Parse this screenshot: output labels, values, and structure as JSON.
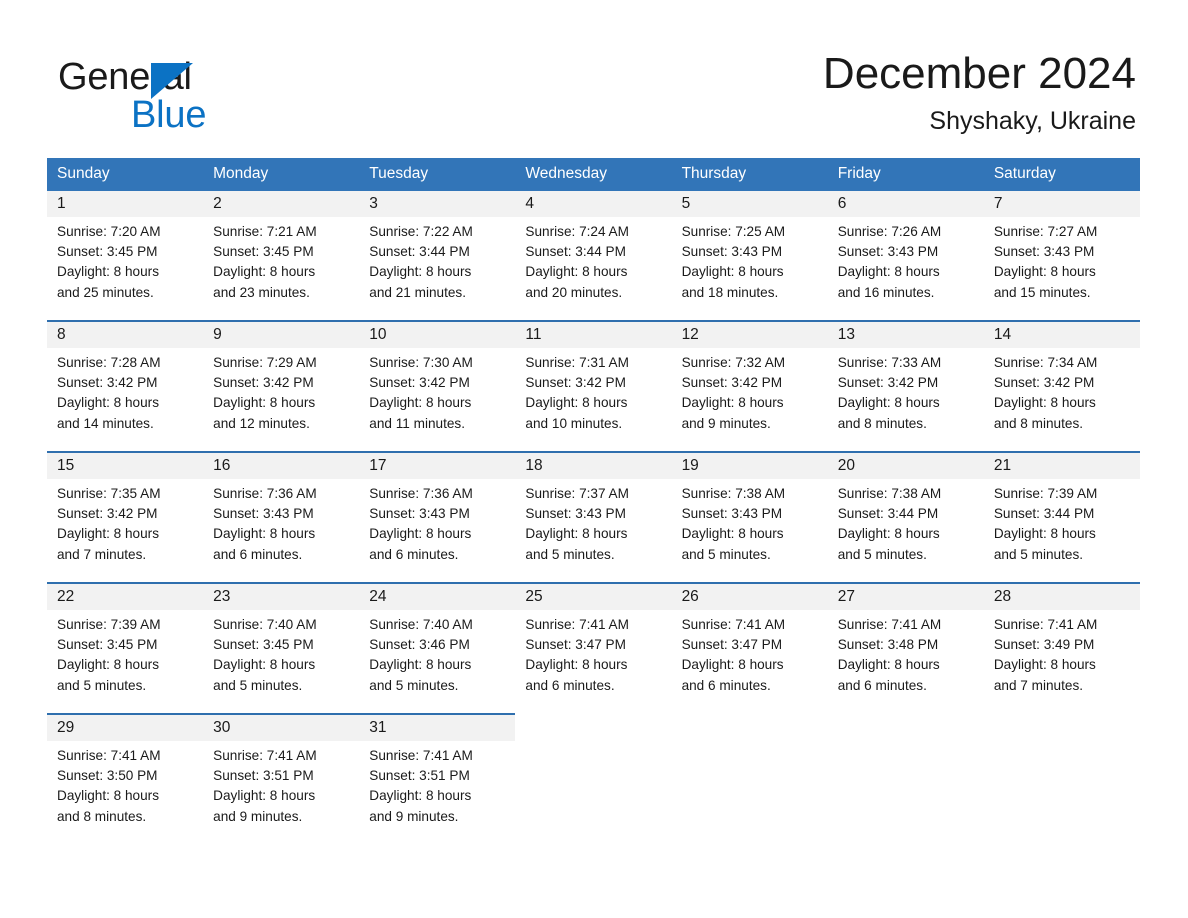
{
  "brand": {
    "name_dark": "General",
    "name_blue": "Blue",
    "accent_color": "#0b72c4"
  },
  "header": {
    "title": "December 2024",
    "location": "Shyshaky, Ukraine"
  },
  "theme": {
    "header_blue": "#3275b8",
    "rule_blue": "#2f6fae",
    "daynum_band": "#f2f2f2",
    "text": "#1a1a1a"
  },
  "weekday_headers": [
    "Sunday",
    "Monday",
    "Tuesday",
    "Wednesday",
    "Thursday",
    "Friday",
    "Saturday"
  ],
  "weeks": [
    {
      "days": [
        {
          "num": "1",
          "sunrise": "Sunrise: 7:20 AM",
          "sunset": "Sunset: 3:45 PM",
          "daylight1": "Daylight: 8 hours",
          "daylight2": "and 25 minutes."
        },
        {
          "num": "2",
          "sunrise": "Sunrise: 7:21 AM",
          "sunset": "Sunset: 3:45 PM",
          "daylight1": "Daylight: 8 hours",
          "daylight2": "and 23 minutes."
        },
        {
          "num": "3",
          "sunrise": "Sunrise: 7:22 AM",
          "sunset": "Sunset: 3:44 PM",
          "daylight1": "Daylight: 8 hours",
          "daylight2": "and 21 minutes."
        },
        {
          "num": "4",
          "sunrise": "Sunrise: 7:24 AM",
          "sunset": "Sunset: 3:44 PM",
          "daylight1": "Daylight: 8 hours",
          "daylight2": "and 20 minutes."
        },
        {
          "num": "5",
          "sunrise": "Sunrise: 7:25 AM",
          "sunset": "Sunset: 3:43 PM",
          "daylight1": "Daylight: 8 hours",
          "daylight2": "and 18 minutes."
        },
        {
          "num": "6",
          "sunrise": "Sunrise: 7:26 AM",
          "sunset": "Sunset: 3:43 PM",
          "daylight1": "Daylight: 8 hours",
          "daylight2": "and 16 minutes."
        },
        {
          "num": "7",
          "sunrise": "Sunrise: 7:27 AM",
          "sunset": "Sunset: 3:43 PM",
          "daylight1": "Daylight: 8 hours",
          "daylight2": "and 15 minutes."
        }
      ]
    },
    {
      "days": [
        {
          "num": "8",
          "sunrise": "Sunrise: 7:28 AM",
          "sunset": "Sunset: 3:42 PM",
          "daylight1": "Daylight: 8 hours",
          "daylight2": "and 14 minutes."
        },
        {
          "num": "9",
          "sunrise": "Sunrise: 7:29 AM",
          "sunset": "Sunset: 3:42 PM",
          "daylight1": "Daylight: 8 hours",
          "daylight2": "and 12 minutes."
        },
        {
          "num": "10",
          "sunrise": "Sunrise: 7:30 AM",
          "sunset": "Sunset: 3:42 PM",
          "daylight1": "Daylight: 8 hours",
          "daylight2": "and 11 minutes."
        },
        {
          "num": "11",
          "sunrise": "Sunrise: 7:31 AM",
          "sunset": "Sunset: 3:42 PM",
          "daylight1": "Daylight: 8 hours",
          "daylight2": "and 10 minutes."
        },
        {
          "num": "12",
          "sunrise": "Sunrise: 7:32 AM",
          "sunset": "Sunset: 3:42 PM",
          "daylight1": "Daylight: 8 hours",
          "daylight2": "and 9 minutes."
        },
        {
          "num": "13",
          "sunrise": "Sunrise: 7:33 AM",
          "sunset": "Sunset: 3:42 PM",
          "daylight1": "Daylight: 8 hours",
          "daylight2": "and 8 minutes."
        },
        {
          "num": "14",
          "sunrise": "Sunrise: 7:34 AM",
          "sunset": "Sunset: 3:42 PM",
          "daylight1": "Daylight: 8 hours",
          "daylight2": "and 8 minutes."
        }
      ]
    },
    {
      "days": [
        {
          "num": "15",
          "sunrise": "Sunrise: 7:35 AM",
          "sunset": "Sunset: 3:42 PM",
          "daylight1": "Daylight: 8 hours",
          "daylight2": "and 7 minutes."
        },
        {
          "num": "16",
          "sunrise": "Sunrise: 7:36 AM",
          "sunset": "Sunset: 3:43 PM",
          "daylight1": "Daylight: 8 hours",
          "daylight2": "and 6 minutes."
        },
        {
          "num": "17",
          "sunrise": "Sunrise: 7:36 AM",
          "sunset": "Sunset: 3:43 PM",
          "daylight1": "Daylight: 8 hours",
          "daylight2": "and 6 minutes."
        },
        {
          "num": "18",
          "sunrise": "Sunrise: 7:37 AM",
          "sunset": "Sunset: 3:43 PM",
          "daylight1": "Daylight: 8 hours",
          "daylight2": "and 5 minutes."
        },
        {
          "num": "19",
          "sunrise": "Sunrise: 7:38 AM",
          "sunset": "Sunset: 3:43 PM",
          "daylight1": "Daylight: 8 hours",
          "daylight2": "and 5 minutes."
        },
        {
          "num": "20",
          "sunrise": "Sunrise: 7:38 AM",
          "sunset": "Sunset: 3:44 PM",
          "daylight1": "Daylight: 8 hours",
          "daylight2": "and 5 minutes."
        },
        {
          "num": "21",
          "sunrise": "Sunrise: 7:39 AM",
          "sunset": "Sunset: 3:44 PM",
          "daylight1": "Daylight: 8 hours",
          "daylight2": "and 5 minutes."
        }
      ]
    },
    {
      "days": [
        {
          "num": "22",
          "sunrise": "Sunrise: 7:39 AM",
          "sunset": "Sunset: 3:45 PM",
          "daylight1": "Daylight: 8 hours",
          "daylight2": "and 5 minutes."
        },
        {
          "num": "23",
          "sunrise": "Sunrise: 7:40 AM",
          "sunset": "Sunset: 3:45 PM",
          "daylight1": "Daylight: 8 hours",
          "daylight2": "and 5 minutes."
        },
        {
          "num": "24",
          "sunrise": "Sunrise: 7:40 AM",
          "sunset": "Sunset: 3:46 PM",
          "daylight1": "Daylight: 8 hours",
          "daylight2": "and 5 minutes."
        },
        {
          "num": "25",
          "sunrise": "Sunrise: 7:41 AM",
          "sunset": "Sunset: 3:47 PM",
          "daylight1": "Daylight: 8 hours",
          "daylight2": "and 6 minutes."
        },
        {
          "num": "26",
          "sunrise": "Sunrise: 7:41 AM",
          "sunset": "Sunset: 3:47 PM",
          "daylight1": "Daylight: 8 hours",
          "daylight2": "and 6 minutes."
        },
        {
          "num": "27",
          "sunrise": "Sunrise: 7:41 AM",
          "sunset": "Sunset: 3:48 PM",
          "daylight1": "Daylight: 8 hours",
          "daylight2": "and 6 minutes."
        },
        {
          "num": "28",
          "sunrise": "Sunrise: 7:41 AM",
          "sunset": "Sunset: 3:49 PM",
          "daylight1": "Daylight: 8 hours",
          "daylight2": "and 7 minutes."
        }
      ]
    },
    {
      "days": [
        {
          "num": "29",
          "sunrise": "Sunrise: 7:41 AM",
          "sunset": "Sunset: 3:50 PM",
          "daylight1": "Daylight: 8 hours",
          "daylight2": "and 8 minutes."
        },
        {
          "num": "30",
          "sunrise": "Sunrise: 7:41 AM",
          "sunset": "Sunset: 3:51 PM",
          "daylight1": "Daylight: 8 hours",
          "daylight2": "and 9 minutes."
        },
        {
          "num": "31",
          "sunrise": "Sunrise: 7:41 AM",
          "sunset": "Sunset: 3:51 PM",
          "daylight1": "Daylight: 8 hours",
          "daylight2": "and 9 minutes."
        },
        {
          "num": "",
          "sunrise": "",
          "sunset": "",
          "daylight1": "",
          "daylight2": ""
        },
        {
          "num": "",
          "sunrise": "",
          "sunset": "",
          "daylight1": "",
          "daylight2": ""
        },
        {
          "num": "",
          "sunrise": "",
          "sunset": "",
          "daylight1": "",
          "daylight2": ""
        },
        {
          "num": "",
          "sunrise": "",
          "sunset": "",
          "daylight1": "",
          "daylight2": ""
        }
      ]
    }
  ]
}
